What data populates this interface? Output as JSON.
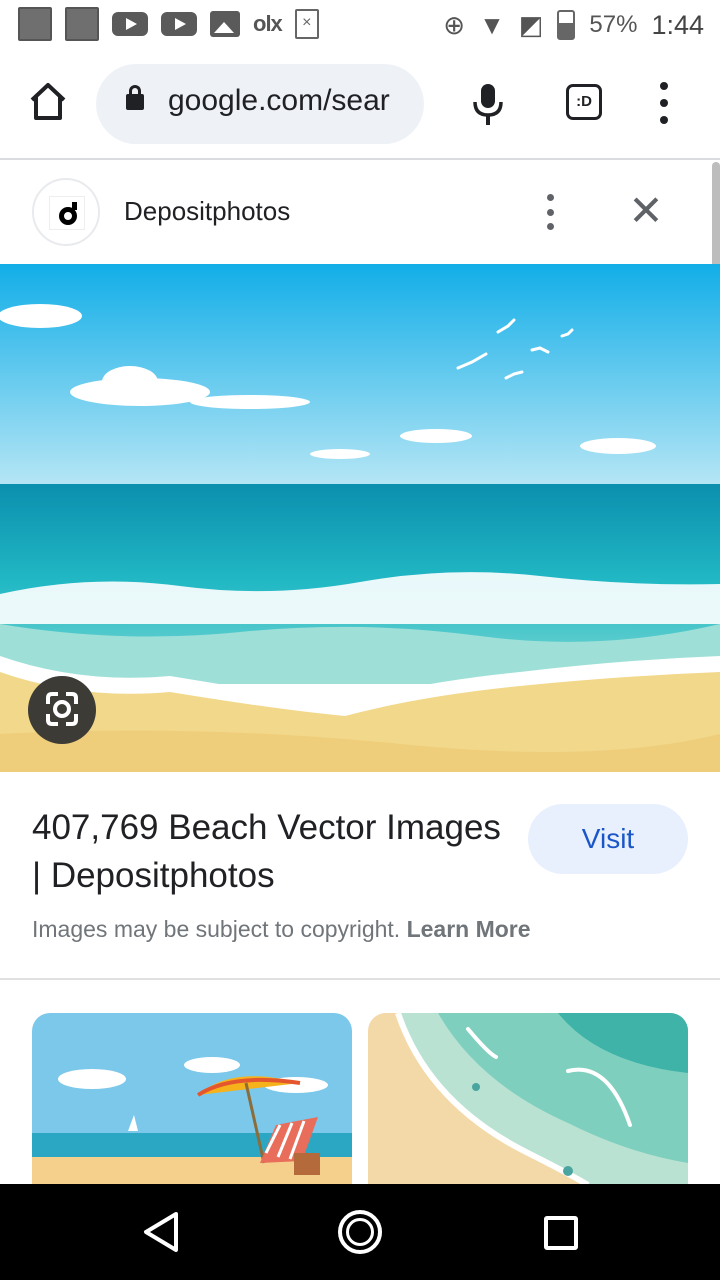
{
  "status_bar": {
    "olx_label": "olx",
    "battery_percent": "57%",
    "battery_level": 0.57,
    "time": "1:44"
  },
  "browser": {
    "url": "google.com/sear",
    "tabs_label": ":D"
  },
  "panel": {
    "site_name": "Depositphotos"
  },
  "result": {
    "title": "407,769 Beach Vector Images | Depositphotos",
    "visit_label": "Visit",
    "copyright_text": "Images may be subject to copyright.",
    "learn_more_label": "Learn More"
  },
  "colors": {
    "visit_bg": "#e8f0fe",
    "visit_text": "#1a56c8",
    "omnibox_bg": "#eef1f6"
  },
  "icons": {
    "home": "home-icon",
    "lock": "lock-icon",
    "mic": "mic-icon",
    "tabs": "tab-switcher-icon",
    "menu": "more-vert-icon",
    "close": "close-icon",
    "lens": "google-lens-icon",
    "nav_back": "back-triangle-icon",
    "nav_home": "home-circle-icon",
    "nav_recent": "recents-square-icon"
  }
}
